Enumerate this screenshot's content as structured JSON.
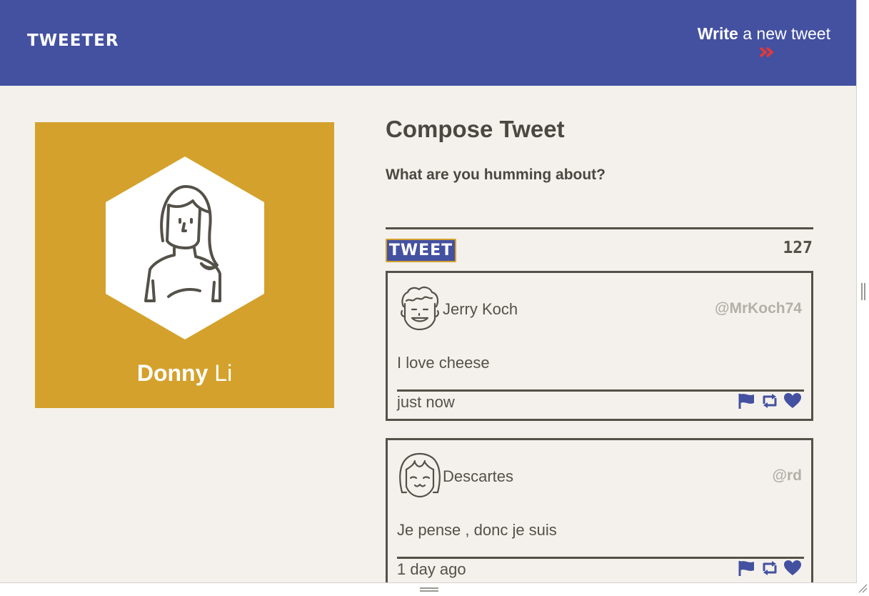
{
  "nav": {
    "brand": "TWEETER",
    "write_bold": "Write",
    "write_rest": " a new tweet",
    "toggle_icon": "double-chevron-down-icon",
    "accent_color": "#e53935"
  },
  "profile": {
    "first_name": "Donny",
    "last_name": "Li",
    "avatar_icon": "woman-avatar-icon",
    "bg_color": "#d4a12c"
  },
  "compose": {
    "title": "Compose Tweet",
    "prompt": "What are you humming about?",
    "button_label": "TWEET",
    "counter": "127"
  },
  "tweets": [
    {
      "name": "Jerry Koch",
      "handle": "@MrKoch74",
      "content": "I love cheese",
      "time": "just now",
      "avatar_icon": "curly-hair-man-avatar-icon"
    },
    {
      "name": "Descartes",
      "handle": "@rd",
      "content": "Je pense , donc je suis",
      "time": "1 day ago",
      "avatar_icon": "bob-hair-avatar-icon"
    }
  ],
  "tweet_actions": [
    "flag-icon",
    "retweet-icon",
    "heart-icon"
  ],
  "colors": {
    "primary": "#4451a0",
    "background": "#f4f1ec",
    "text": "#545149",
    "handle": "#b3b0aa"
  }
}
